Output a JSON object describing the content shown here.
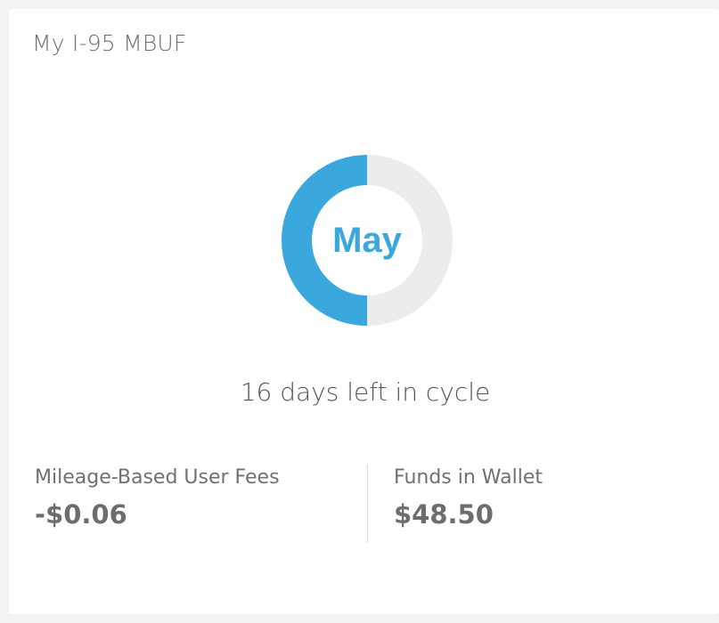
{
  "card": {
    "title": "My I-95 MBUF"
  },
  "cycle": {
    "month": "May",
    "progress_fraction": 0.5,
    "days_left_text": "16 days left in cycle",
    "accent_color": "#3aa8dc",
    "track_color": "#ececec"
  },
  "stats": {
    "fees_label": "Mileage-Based User Fees",
    "fees_value": "-$0.06",
    "wallet_label": "Funds in Wallet",
    "wallet_value": "$48.50"
  }
}
